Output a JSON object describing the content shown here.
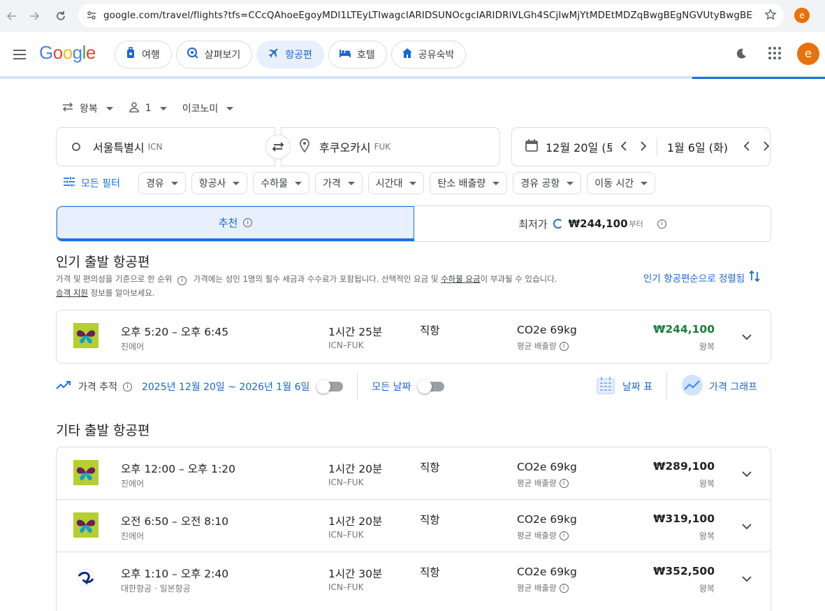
{
  "browser": {
    "url": "google.com/travel/flights?tfs=CCcQAhoeEgoyMDI1LTEyLTIwagcIARIDSUNOcgcIARIDRlVLGh4SCjIwMjYtMDEtMDZqBwgBEgNGVUtyBwgBEgNJQ05...",
    "profile_initial": "e"
  },
  "header": {
    "logo_text": "Google",
    "tabs": [
      {
        "label": "여행",
        "icon": "travel-icon"
      },
      {
        "label": "살펴보기",
        "icon": "explore-icon"
      },
      {
        "label": "항공편",
        "icon": "flight-icon",
        "active": true
      },
      {
        "label": "호텔",
        "icon": "hotel-icon"
      },
      {
        "label": "공유숙박",
        "icon": "home-icon"
      }
    ],
    "avatar_initial": "e"
  },
  "search": {
    "trip_type": "왕복",
    "passengers": "1",
    "cabin": "이코노미",
    "origin": {
      "city": "서울특별시",
      "code": "ICN"
    },
    "destination": {
      "city": "후쿠오카시",
      "code": "FUK"
    },
    "depart_date": "12월 20일 (토",
    "return_date": "1월 6일 (화)"
  },
  "filters": {
    "all_filters_label": "모든 필터",
    "chips": [
      "경유",
      "항공사",
      "수하물",
      "가격",
      "시간대",
      "탄소 배출량",
      "경유 공항",
      "이동 시간"
    ]
  },
  "sort_tabs": {
    "recommended": "추천",
    "cheapest": "최저가",
    "cheapest_price": "₩244,100",
    "cheapest_suffix": "부터"
  },
  "top_section": {
    "title": "인기 출발 항공편",
    "notice_part1": "가격 및 편의성을 기준으로 한 순위",
    "notice_part2": "가격에는 성인 1명의 필수 세금과 수수료가 포함됩니다. 선택적인 요금 및",
    "notice_link1": "수하물 요금",
    "notice_part3": "이 부과될 수 있습니다.",
    "notice_link2": "승객 지원",
    "notice_part4": "정보를 알아보세요.",
    "sort_link": "인기 항공편순으로 정렬됨"
  },
  "top_flights": [
    {
      "time": "오후 5:20 – 오후 6:45",
      "airline": "진에어",
      "duration": "1시간 25분",
      "route": "ICN–FUK",
      "stops": "직항",
      "co2": "CO2e 69kg",
      "co2_sub": "평균 배출량",
      "price": "₩244,100",
      "price_type": "왕복",
      "logo": "jinair",
      "cheapest": true
    }
  ],
  "tracker": {
    "label": "가격 추적",
    "dates": "2025년 12월 20일 ~ 2026년 1월 6일",
    "all_dates": "모든 날짜",
    "date_grid": "날짜 표",
    "price_graph": "가격 그래프"
  },
  "other_section": {
    "title": "기타 출발 항공편"
  },
  "other_flights": [
    {
      "time": "오후 12:00 – 오후 1:20",
      "airline": "진에어",
      "duration": "1시간 20분",
      "route": "ICN–FUK",
      "stops": "직항",
      "co2": "CO2e 69kg",
      "co2_sub": "평균 배출량",
      "price": "₩289,100",
      "price_type": "왕복",
      "logo": "jinair"
    },
    {
      "time": "오전 6:50 – 오전 8:10",
      "airline": "진에어",
      "duration": "1시간 20분",
      "route": "ICN–FUK",
      "stops": "직항",
      "co2": "CO2e 69kg",
      "co2_sub": "평균 배출량",
      "price": "₩319,100",
      "price_type": "왕복",
      "logo": "jinair"
    },
    {
      "time": "오후 1:10 – 오후 2:40",
      "airline": "대한항공 · 일본항공",
      "duration": "1시간 30분",
      "route": "ICN–FUK",
      "stops": "직항",
      "co2": "CO2e 69kg",
      "co2_sub": "평균 배출량",
      "price": "₩352,500",
      "price_type": "왕복",
      "logo": "koreanair"
    }
  ],
  "colors": {
    "accent": "#1a73e8",
    "price_green": "#188038",
    "active_tab_bg": "#e8f0fe"
  }
}
